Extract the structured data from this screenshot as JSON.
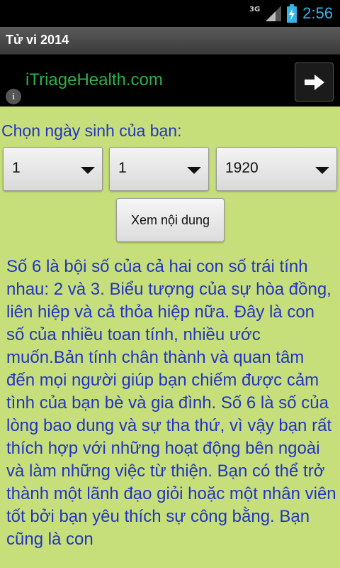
{
  "status": {
    "network": "3G",
    "time": "2:56",
    "battery_icon": "battery-charging-icon",
    "signal_icon": "signal-icon"
  },
  "app": {
    "title": "Tử vi 2014"
  },
  "ad": {
    "text": "iTriageHealth.com",
    "info_label": "i",
    "arrow_icon": "arrow-right-icon"
  },
  "form": {
    "label": "Chọn ngày sinh của bạn:",
    "day": "1",
    "month": "1",
    "year": "1920",
    "submit_label": "Xem nội dung"
  },
  "content": {
    "text": "Số 6 là bội số của cả hai con số trái tính nhau: 2 và 3. Biểu tượng của sự hòa đồng, liên hiệp và cả thỏa hiệp nữa. Đây là con số của nhiều toan tính, nhiều ước muốn.Bản tính chân thành và quan tâm đến mọi người giúp bạn chiếm được cảm tình của bạn bè và gia đình. Số 6 là số của lòng bao dung và sự tha thứ, vì vậy bạn rất thích hợp với những hoạt động bên ngoài và làm những việc từ thiện. Bạn có thể trở thành một lãnh đạo giỏi hoặc một nhân viên tốt bởi bạn yêu thích sự công bằng. Bạn cũng là con"
  },
  "colors": {
    "background": "#c6df7a",
    "text": "#2334c3",
    "ad_text": "#2fae49",
    "clock": "#33b5e5"
  }
}
